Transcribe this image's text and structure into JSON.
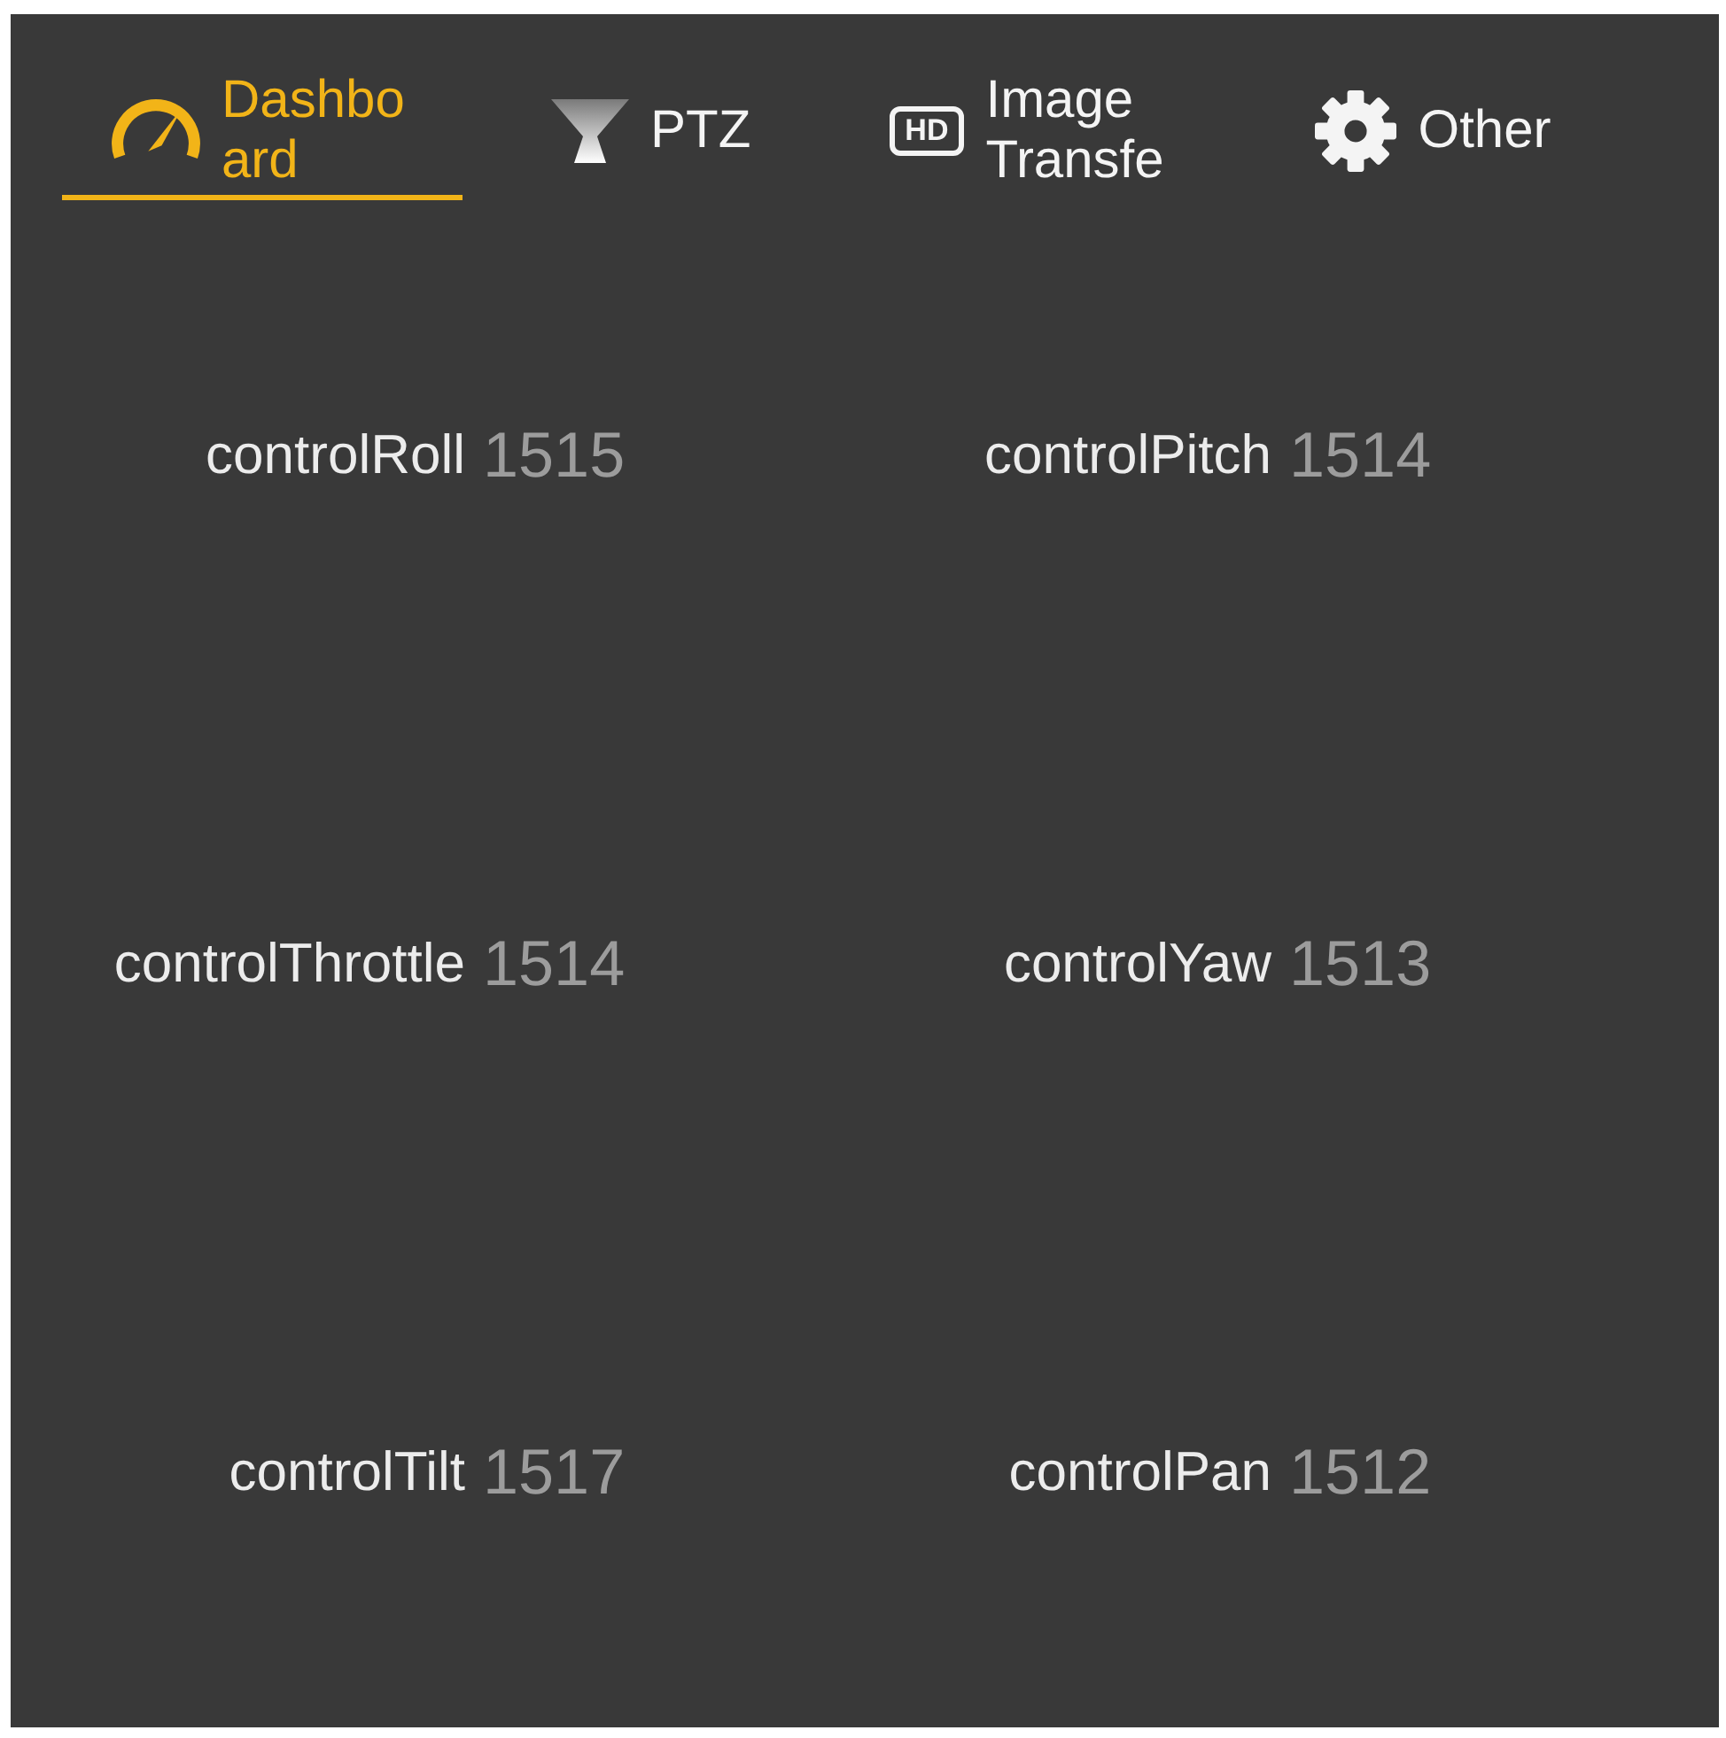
{
  "tabs": [
    {
      "label": "Dashboard",
      "selected": true
    },
    {
      "label": "PTZ",
      "selected": false
    },
    {
      "label": "Image Transfe",
      "badge": "HD",
      "selected": false
    },
    {
      "label": "Other",
      "selected": false
    }
  ],
  "channels": [
    {
      "name": "controlRoll",
      "value": "1515"
    },
    {
      "name": "controlPitch",
      "value": "1514"
    },
    {
      "name": "controlThrottle",
      "value": "1514"
    },
    {
      "name": "controlYaw",
      "value": "1513"
    },
    {
      "name": "controlTilt",
      "value": "1517"
    },
    {
      "name": "controlPan",
      "value": "1512"
    }
  ]
}
